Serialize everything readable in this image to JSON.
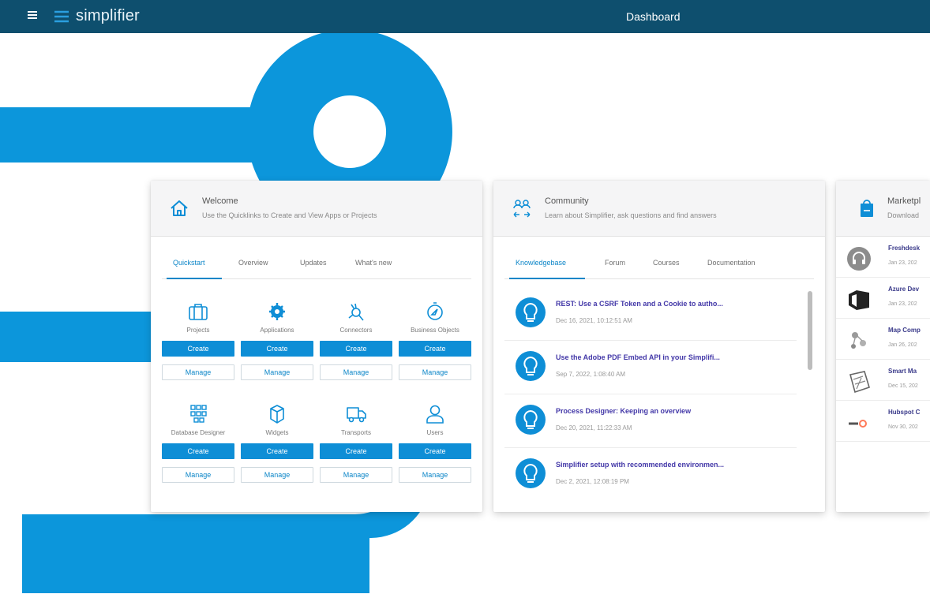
{
  "topbar": {
    "brand": "simplifier",
    "title": "Dashboard",
    "background": "#0e4f6e"
  },
  "colors": {
    "accent": "#0e8ed6",
    "art_blue": "#0c96db",
    "link_purple": "#4338a8"
  },
  "welcome": {
    "title": "Welcome",
    "subtitle": "Use the Quicklinks to Create and View Apps or Projects",
    "icon": "home-icon",
    "tabs": [
      {
        "label": "Quickstart",
        "active": true
      },
      {
        "label": "Overview",
        "active": false
      },
      {
        "label": "Updates",
        "active": false
      },
      {
        "label": "What's new",
        "active": false
      }
    ],
    "quickstart": [
      {
        "label": "Projects",
        "icon": "briefcase-icon",
        "create": "Create",
        "manage": "Manage"
      },
      {
        "label": "Applications",
        "icon": "gear-icon",
        "create": "Create",
        "manage": "Manage"
      },
      {
        "label": "Connectors",
        "icon": "plug-icon",
        "create": "Create",
        "manage": "Manage"
      },
      {
        "label": "Business Objects",
        "icon": "compass-icon",
        "create": "Create",
        "manage": "Manage"
      },
      {
        "label": "Database Designer",
        "icon": "database-icon",
        "create": "Create",
        "manage": "Manage"
      },
      {
        "label": "Widgets",
        "icon": "cube-icon",
        "create": "Create",
        "manage": "Manage"
      },
      {
        "label": "Transports",
        "icon": "truck-icon",
        "create": "Create",
        "manage": "Manage"
      },
      {
        "label": "Users",
        "icon": "user-icon",
        "create": "Create",
        "manage": "Manage"
      }
    ]
  },
  "community": {
    "title": "Community",
    "subtitle": "Learn about Simplifier, ask questions and find answers",
    "icon": "community-icon",
    "tabs": [
      {
        "label": "Knowledgebase",
        "active": true
      },
      {
        "label": "Forum",
        "active": false
      },
      {
        "label": "Courses",
        "active": false
      },
      {
        "label": "Documentation",
        "active": false
      }
    ],
    "articles": [
      {
        "title": "REST: Use a CSRF Token and a Cookie to autho...",
        "date": "Dec 16, 2021, 10:12:51 AM"
      },
      {
        "title": "Use the Adobe PDF Embed API in your Simplifi...",
        "date": "Sep 7, 2022, 1:08:40 AM"
      },
      {
        "title": "Process Designer: Keeping an overview",
        "date": "Dec 20, 2021, 11:22:33 AM"
      },
      {
        "title": "Simplifier setup with recommended environmen...",
        "date": "Dec 2, 2021, 12:08:19 PM"
      }
    ]
  },
  "marketplace": {
    "title": "Marketpl",
    "subtitle": "Download",
    "icon": "shopping-bag-icon",
    "items": [
      {
        "title": "Freshdesk",
        "date": "Jan 23, 202",
        "logo": "freshdesk-logo"
      },
      {
        "title": "Azure Dev",
        "date": "Jan 23, 202",
        "logo": "azure-devops-logo"
      },
      {
        "title": "Map Comp",
        "date": "Jan 26, 202",
        "logo": "map-component-logo"
      },
      {
        "title": "Smart Ma",
        "date": "Dec 15, 202",
        "logo": "smart-map-logo"
      },
      {
        "title": "Hubspot C",
        "date": "Nov 30, 202",
        "logo": "hubspot-logo"
      }
    ]
  }
}
